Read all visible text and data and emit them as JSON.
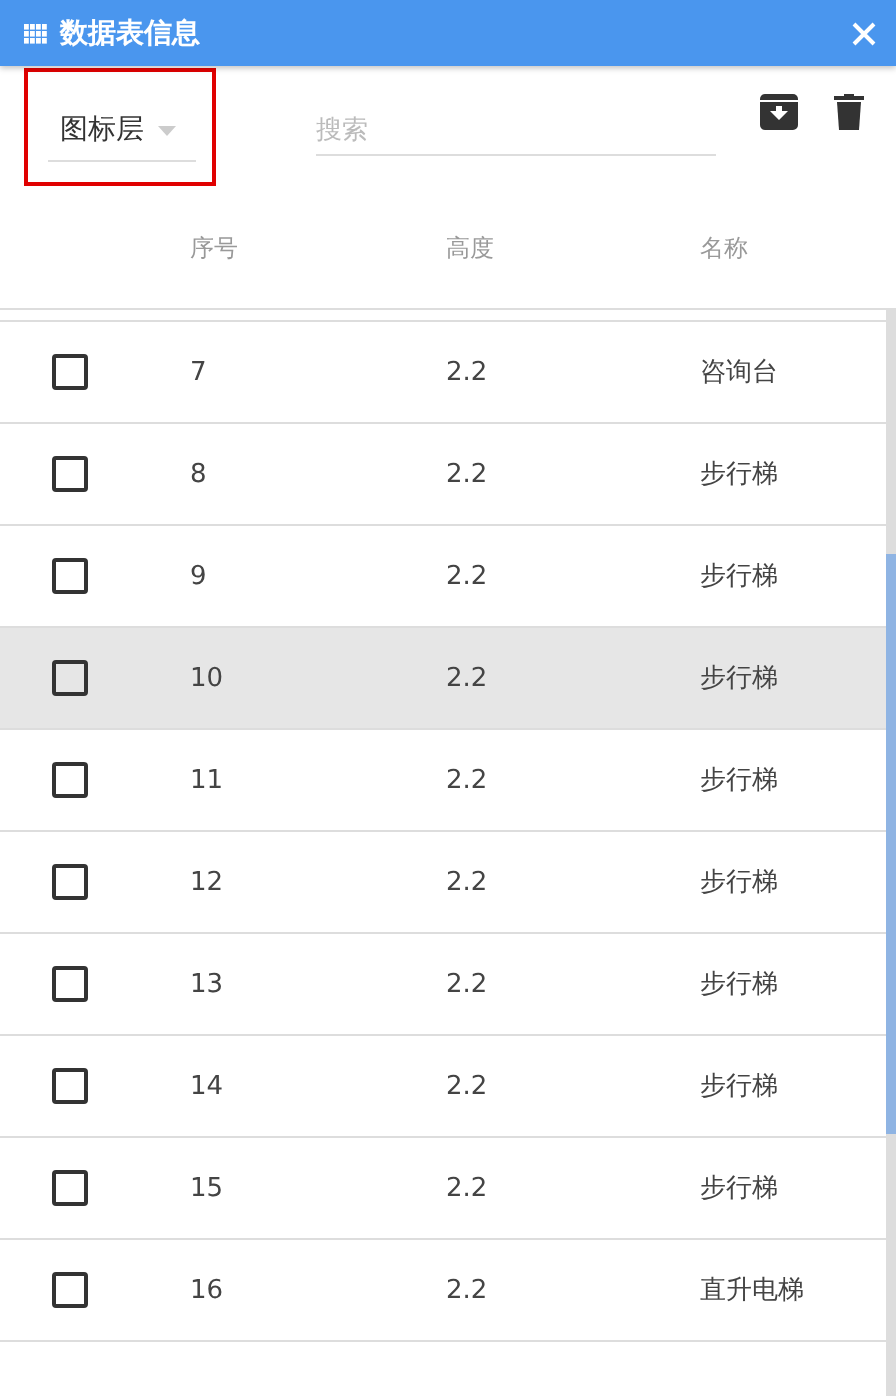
{
  "window": {
    "title": "数据表信息"
  },
  "toolbar": {
    "layer_select": {
      "value": "图标层",
      "highlighted": true
    },
    "search": {
      "placeholder": "搜索"
    }
  },
  "table": {
    "columns": [
      "序号",
      "高度",
      "名称"
    ],
    "rows": [
      {
        "cells": [
          "7",
          "2.2",
          "咨询台"
        ],
        "checked": false,
        "selected": false
      },
      {
        "cells": [
          "8",
          "2.2",
          "步行梯"
        ],
        "checked": false,
        "selected": false
      },
      {
        "cells": [
          "9",
          "2.2",
          "步行梯"
        ],
        "checked": false,
        "selected": false
      },
      {
        "cells": [
          "10",
          "2.2",
          "步行梯"
        ],
        "checked": false,
        "selected": true
      },
      {
        "cells": [
          "11",
          "2.2",
          "步行梯"
        ],
        "checked": false,
        "selected": false
      },
      {
        "cells": [
          "12",
          "2.2",
          "步行梯"
        ],
        "checked": false,
        "selected": false
      },
      {
        "cells": [
          "13",
          "2.2",
          "步行梯"
        ],
        "checked": false,
        "selected": false
      },
      {
        "cells": [
          "14",
          "2.2",
          "步行梯"
        ],
        "checked": false,
        "selected": false
      },
      {
        "cells": [
          "15",
          "2.2",
          "步行梯"
        ],
        "checked": false,
        "selected": false
      },
      {
        "cells": [
          "16",
          "2.2",
          "直升电梯"
        ],
        "checked": false,
        "selected": false
      }
    ]
  }
}
